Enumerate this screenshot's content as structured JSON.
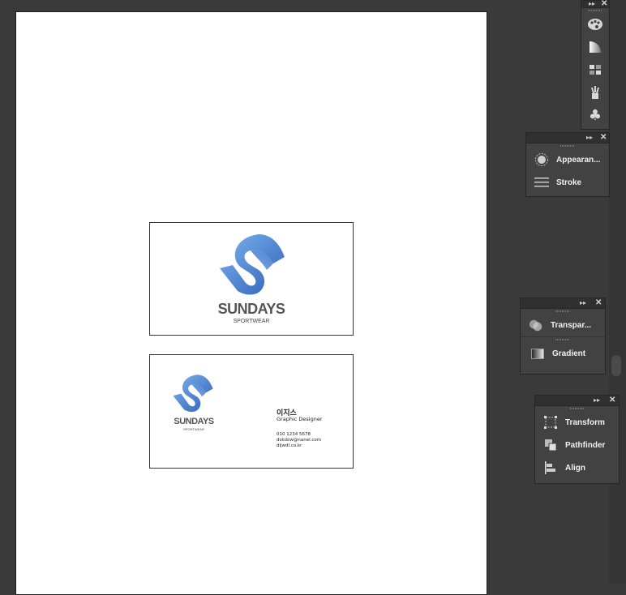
{
  "front_card": {
    "brand": "SUNDAYS",
    "tagline": "SPORTWEAR"
  },
  "back_card": {
    "brand": "SUNDAYS",
    "tagline": "SPORTWEAR",
    "name": "이지스",
    "title": "Graphic Designer",
    "phone": "010 1234 5678",
    "email": "dskdow@nanel.com",
    "web": "dljwdl.co.kr"
  },
  "tool_strip": {
    "icons": [
      "palette-icon",
      "gradient-swatch-icon",
      "swatch-grid-icon",
      "brush-icon",
      "club-symbol-icon"
    ]
  },
  "panels": {
    "appearance_label": "Appearan...",
    "stroke_label": "Stroke",
    "transparency_label": "Transpar...",
    "gradient_label": "Gradient",
    "transform_label": "Transform",
    "pathfinder_label": "Pathfinder",
    "align_label": "Align"
  },
  "colors": {
    "logo_light": "#6aa5e4",
    "logo_dark": "#2f5fb8",
    "workspace": "#3a3a3a",
    "panel": "#424242"
  }
}
